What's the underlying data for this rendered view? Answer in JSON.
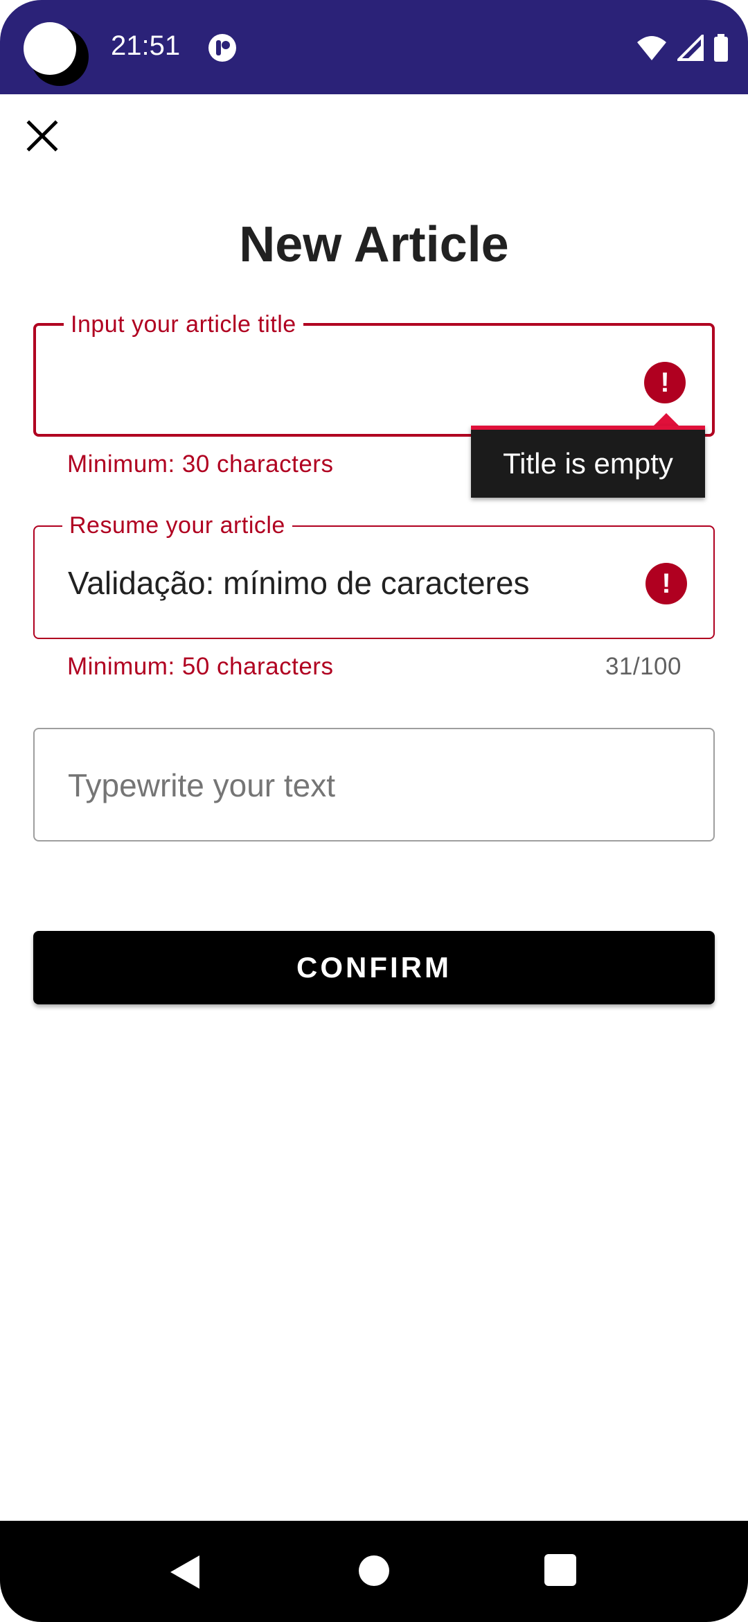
{
  "status_bar": {
    "time": "21:51"
  },
  "header": {
    "title": "New Article"
  },
  "form": {
    "title_field": {
      "label": "Input your article title",
      "value": "",
      "helper": "Minimum: 30 characters",
      "tooltip": "Title is empty"
    },
    "resume_field": {
      "label": "Resume your article",
      "value": "Validação: mínimo de caracteres",
      "helper": "Minimum: 50 characters",
      "counter": "31/100"
    },
    "text_field": {
      "placeholder": "Typewrite your text"
    },
    "confirm_label": "CONFIRM"
  },
  "icons": {
    "close": "close-icon",
    "error": "error-icon",
    "error_glyph": "!",
    "wifi": "wifi-icon",
    "signal": "cell-signal-icon",
    "battery": "battery-icon"
  },
  "colors": {
    "status_bar": "#2b2278",
    "error": "#b00020",
    "tooltip_accent": "#e0103a",
    "button": "#000000"
  }
}
